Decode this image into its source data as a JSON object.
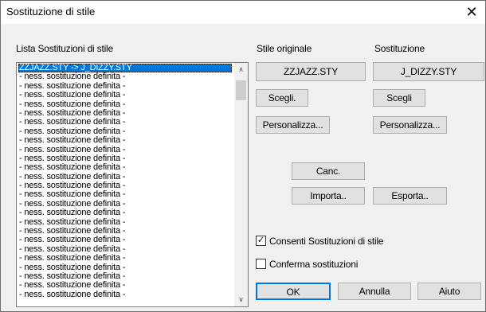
{
  "window": {
    "title": "Sostituzione di stile",
    "close_glyph": "✕"
  },
  "list": {
    "label": "Lista Sostituzioni di stile",
    "items": [
      "ZZJAZZ.STY -> J_DIZZY.STY",
      "- ness. sostituzione definita -",
      "- ness. sostituzione definita -",
      "- ness. sostituzione definita -",
      "- ness. sostituzione definita -",
      "- ness. sostituzione definita -",
      "- ness. sostituzione definita -",
      "- ness. sostituzione definita -",
      "- ness. sostituzione definita -",
      "- ness. sostituzione definita -",
      "- ness. sostituzione definita -",
      "- ness. sostituzione definita -",
      "- ness. sostituzione definita -",
      "- ness. sostituzione definita -",
      "- ness. sostituzione definita -",
      "- ness. sostituzione definita -",
      "- ness. sostituzione definita -",
      "- ness. sostituzione definita -",
      "- ness. sostituzione definita -",
      "- ness. sostituzione definita -",
      "- ness. sostituzione definita -",
      "- ness. sostituzione definita -",
      "- ness. sostituzione definita -",
      "- ness. sostituzione definita -",
      "- ness. sostituzione definita -",
      "- ness. sostituzione definita -"
    ],
    "scroll_up_glyph": "∧",
    "scroll_down_glyph": "∨"
  },
  "original": {
    "label": "Stile originale",
    "value": "ZZJAZZ.STY",
    "choose": "Scegli.",
    "customize": "Personalizza..."
  },
  "replacement": {
    "label": "Sostituzione",
    "value": "J_DIZZY.STY",
    "choose": "Scegli",
    "customize": "Personalizza..."
  },
  "actions": {
    "delete": "Canc.",
    "import": "Importa..",
    "export": "Esporta.."
  },
  "options": {
    "enable": {
      "label": "Consenti Sostituzioni di stile",
      "checked": true,
      "mark": "✓"
    },
    "confirm": {
      "label": "Conferma sostituzioni",
      "checked": false,
      "mark": ""
    }
  },
  "footer": {
    "ok": "OK",
    "cancel": "Annulla",
    "help": "Aiuto"
  }
}
